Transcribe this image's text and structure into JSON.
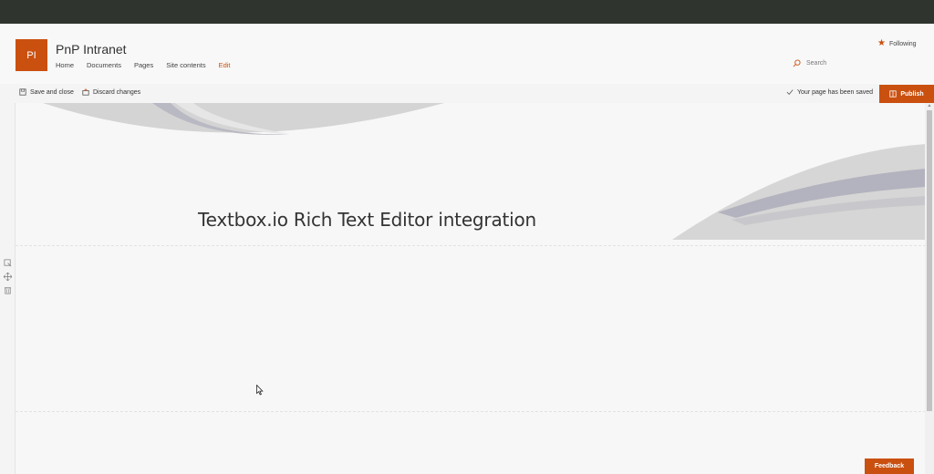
{
  "site": {
    "logo_text": "PI",
    "title": "PnP Intranet",
    "nav": [
      "Home",
      "Documents",
      "Pages",
      "Site contents",
      "Edit"
    ],
    "follow_label": "Following",
    "search_placeholder": "Search"
  },
  "toolbar": {
    "save_close": "Save and close",
    "discard": "Discard changes",
    "saved_status": "Your page has been saved",
    "publish": "Publish"
  },
  "page": {
    "hero_title": "Textbox.io Rich Text Editor integration"
  },
  "footer": {
    "feedback": "Feedback"
  },
  "colors": {
    "accent": "#ca5010",
    "topbar": "#30342f"
  },
  "icons": [
    "star-icon",
    "search-icon",
    "save-icon",
    "discard-icon",
    "checkmark-icon",
    "publish-icon",
    "edit-section-icon",
    "move-icon",
    "delete-icon"
  ]
}
